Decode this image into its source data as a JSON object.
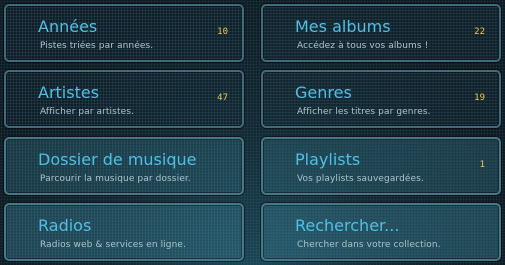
{
  "tiles": [
    {
      "title": "Années",
      "subtitle": "Pistes triées par années.",
      "count": "10"
    },
    {
      "title": "Mes albums",
      "subtitle": "Accédez à tous vos albums !",
      "count": "22"
    },
    {
      "title": "Artistes",
      "subtitle": "Afficher par artistes.",
      "count": "47"
    },
    {
      "title": "Genres",
      "subtitle": "Afficher les titres par genres.",
      "count": "19"
    },
    {
      "title": "Dossier de musique",
      "subtitle": "Parcourir la musique par dossier.",
      "count": ""
    },
    {
      "title": "Playlists",
      "subtitle": "Vos playlists sauvegardées.",
      "count": "1"
    },
    {
      "title": "Radios",
      "subtitle": "Radios web & services en ligne.",
      "count": ""
    },
    {
      "title": "Rechercher...",
      "subtitle": "Chercher dans votre collection.",
      "count": ""
    }
  ],
  "colors": {
    "background": "#0d1a22",
    "tile_border": "#3f6b7a",
    "title": "#4fc0e4",
    "subtitle": "#a9c2cb",
    "count": "#f0c84a"
  }
}
